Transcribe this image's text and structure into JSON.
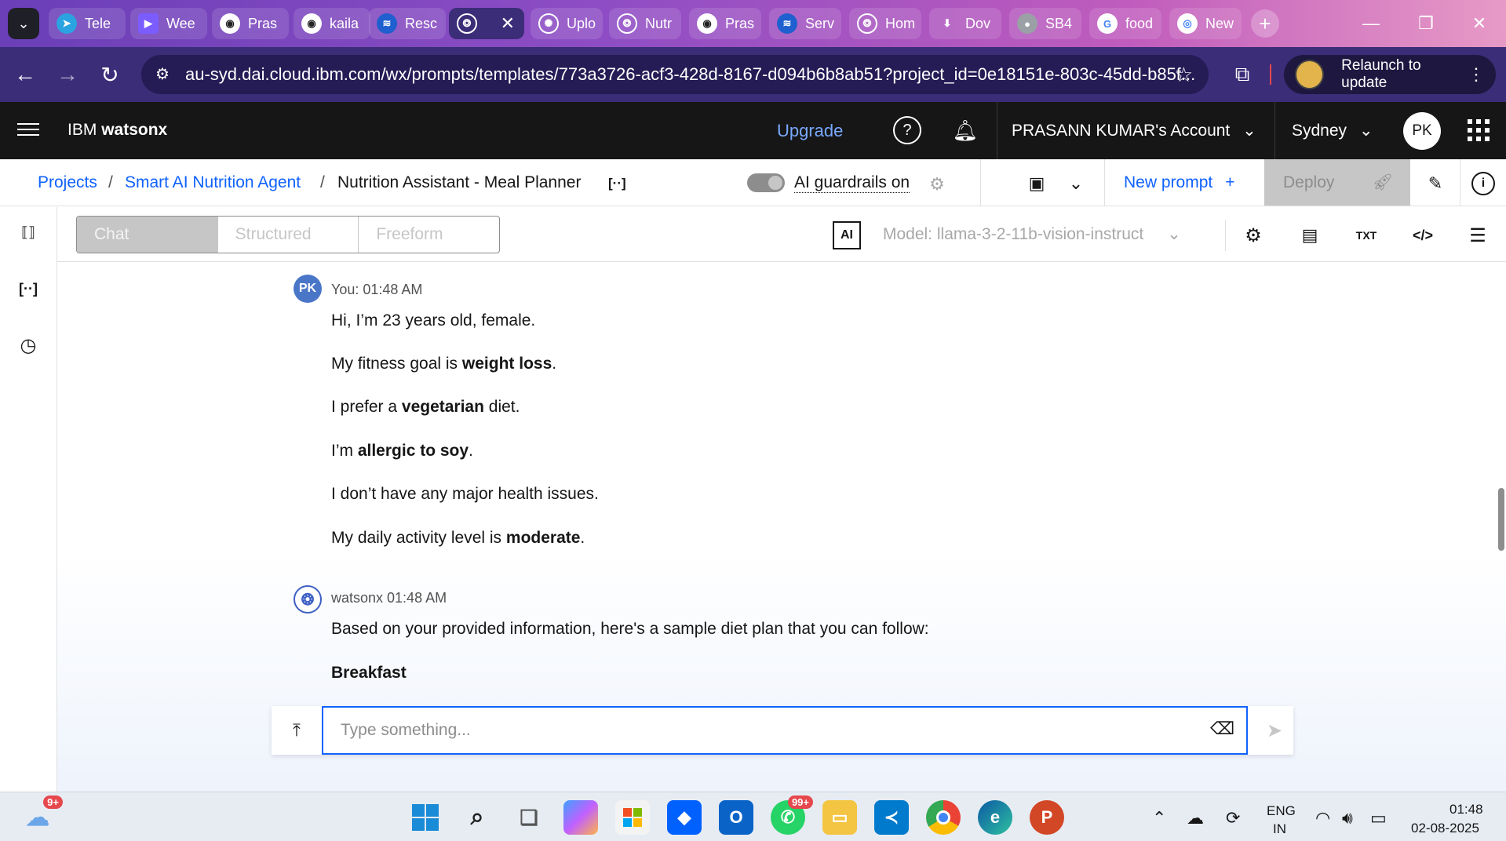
{
  "browser": {
    "tabs": [
      {
        "label": "Tele",
        "icon": "telegram-icon",
        "color": "#2aa3e0"
      },
      {
        "label": "Wee",
        "icon": "video-icon",
        "color": "#7b5cff"
      },
      {
        "label": "Pras",
        "icon": "github-icon",
        "color": "#222222"
      },
      {
        "label": "kaila",
        "icon": "github-icon",
        "color": "#222222"
      },
      {
        "label": "Resc",
        "icon": "ibm-icon",
        "color": "#1f5fcf"
      },
      {
        "label": "",
        "icon": "watsonx-icon",
        "color": "#ffffff",
        "active": true
      },
      {
        "label": "Uplo",
        "icon": "openai-icon",
        "color": "#ffffff"
      },
      {
        "label": "Nutr",
        "icon": "watsonx-icon",
        "color": "#ffffff"
      },
      {
        "label": "Pras",
        "icon": "github-icon",
        "color": "#222222"
      },
      {
        "label": "Serv",
        "icon": "ibm-icon",
        "color": "#1f5fcf"
      },
      {
        "label": "Hom",
        "icon": "watsonx-icon",
        "color": "#ffffff"
      },
      {
        "label": "Dov",
        "icon": "download-icon",
        "color": "#ffffff"
      },
      {
        "label": "SB4",
        "icon": "globe-icon",
        "color": "#9aa0a6"
      },
      {
        "label": "food",
        "icon": "google-icon",
        "color": "#ffffff"
      },
      {
        "label": "New",
        "icon": "chrome-icon",
        "color": "#ffffff"
      }
    ],
    "url": "au-syd.dai.cloud.ibm.com/wx/prompts/templates/773a3726-acf3-428d-8167-d094b6b8ab51?project_id=0e18151e-803c-45dd-b85f...",
    "relaunch_label": "Relaunch to update"
  },
  "header": {
    "brand_prefix": "IBM",
    "brand_name": "watsonx",
    "upgrade_label": "Upgrade",
    "account_label": "PRASANN KUMAR's Account",
    "region_label": "Sydney",
    "avatar_initials": "PK"
  },
  "breadcrumb": {
    "projects": "Projects",
    "project": "Smart AI Nutrition Agent",
    "current": "Nutrition Assistant - Meal Planner",
    "variables_icon": "[··]",
    "guardrails_label": "AI guardrails on",
    "new_prompt_label": "New prompt",
    "new_prompt_plus": "+",
    "deploy_label": "Deploy"
  },
  "modebar": {
    "modes": [
      "Chat",
      "Structured",
      "Freeform"
    ],
    "ai_badge": "AI",
    "model_label": "Model: llama-3-2-11b-vision-instruct",
    "txt_label": "TXT"
  },
  "chat": {
    "user_initials": "PK",
    "user_meta": "You: 01:48 AM",
    "user_lines": [
      {
        "pre": "Hi, I’m 23 years old, female.",
        "bold": "",
        "post": ""
      },
      {
        "pre": "My fitness goal is ",
        "bold": "weight loss",
        "post": "."
      },
      {
        "pre": "I prefer a ",
        "bold": "vegetarian",
        "post": " diet."
      },
      {
        "pre": "I’m ",
        "bold": "allergic to soy",
        "post": "."
      },
      {
        "pre": "I don’t have any major health issues.",
        "bold": "",
        "post": ""
      },
      {
        "pre": "My daily activity level is ",
        "bold": "moderate",
        "post": "."
      }
    ],
    "bot_meta": "watsonx 01:48 AM",
    "bot_intro": "Based on your provided information, here's a sample diet plan that you can follow:",
    "bot_heading": "Breakfast",
    "input_placeholder": "Type something..."
  },
  "taskbar": {
    "weather_badge": "9+",
    "whatsapp_badge": "99+",
    "language_top": "ENG",
    "language_bottom": "IN",
    "time": "01:48",
    "date": "02-08-2025"
  },
  "colors": {
    "ibm_blue": "#0f62fe",
    "header_bg": "#161616",
    "chrome_purple": "#3b2d78"
  }
}
